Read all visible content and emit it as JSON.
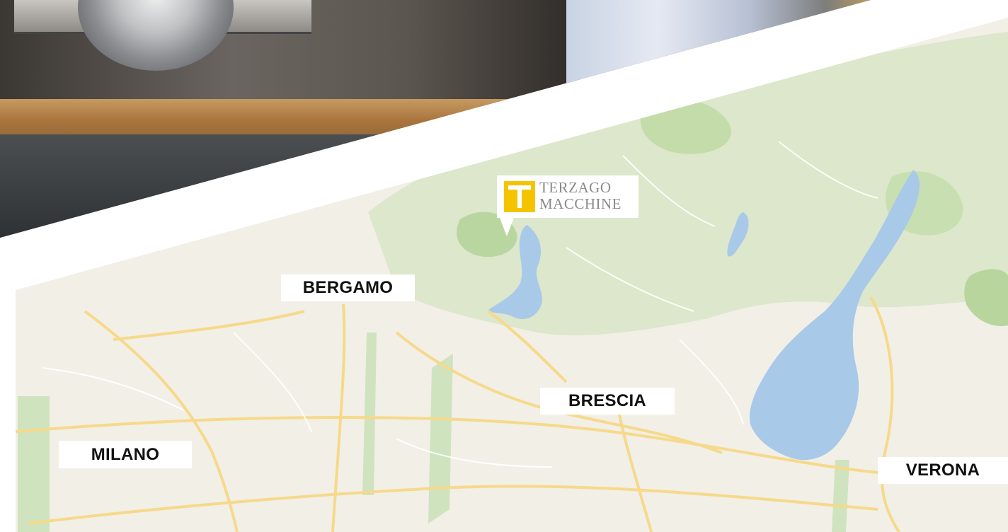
{
  "photo": {
    "description_icon": "stone-cutting-machine-photo"
  },
  "map": {
    "cities": {
      "milano": "MILANO",
      "bergamo": "BERGAMO",
      "brescia": "BRESCIA",
      "verona": "VERONA"
    },
    "marker": {
      "brand_line1": "TERZAGO",
      "brand_line2": "MACCHINE",
      "logo_icon": "terzago-t-logo-icon"
    },
    "colors": {
      "land": "#f2efe7",
      "water": "#a9c9e8",
      "green": "#cfe3bf",
      "road": "#f6d98a",
      "logo_yellow": "#f5c400"
    }
  }
}
